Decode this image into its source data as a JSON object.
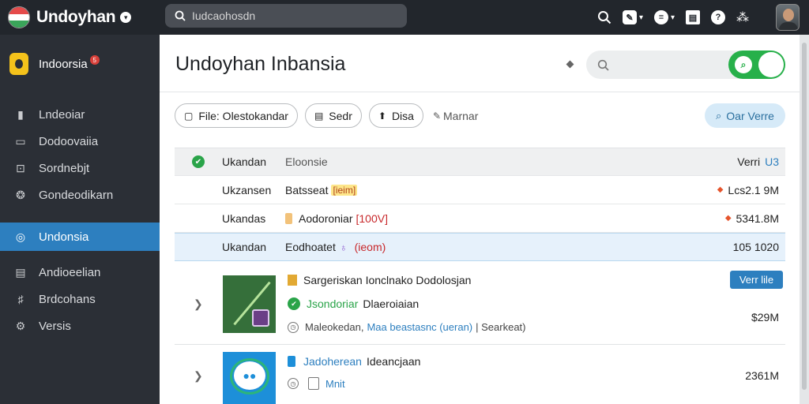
{
  "app": {
    "name": "Undoyhan",
    "search_value": "Iudcaohosdn"
  },
  "sidebar": {
    "brand_label": "Indoorsia",
    "badge": "5",
    "items": [
      {
        "label": "Lndeoiar",
        "icon": "folder-icon"
      },
      {
        "label": "Dodoovaiia",
        "icon": "inbox-icon"
      },
      {
        "label": "Sordnebjt",
        "icon": "person-icon"
      },
      {
        "label": "Gondeodikarn",
        "icon": "group-icon"
      },
      {
        "label": "Undonsia",
        "icon": "globe-icon"
      },
      {
        "label": "Andioeelian",
        "icon": "chat-icon"
      },
      {
        "label": "Brdcohans",
        "icon": "grid-icon"
      },
      {
        "label": "Versis",
        "icon": "gear-icon"
      }
    ]
  },
  "main": {
    "title": "Undoyhan Inbansia",
    "toolbar": {
      "file_label": "File: Olestokandar",
      "sedr_label": "Sedr",
      "disa_label": "Disa",
      "marnar_label": "Marnar",
      "view_label": "Oar Verre"
    },
    "table": {
      "header": {
        "name": "Ukandan",
        "desc": "Eloonsie",
        "size": "Verri",
        "size_extra": "U3"
      },
      "rows": [
        {
          "name": "Ukzansen",
          "desc": "Batsseat",
          "tag": "[ieim]",
          "size": "Lcs2.1 9M"
        },
        {
          "name": "Ukandas",
          "desc": "Aodoroniar",
          "tag": "[100V]",
          "size": "5341.8M"
        },
        {
          "name": "Ukandan",
          "desc": "Eodhoatet",
          "tag": "(ieom)",
          "size": "105 1020"
        }
      ]
    },
    "cards": [
      {
        "title": "Sargeriskan Ionclnako Dodolosjan",
        "line2_green": "Jsondoriar",
        "line2": "Dlaeroiaian",
        "line3_pre": "Maleokedan,",
        "line3_link": "Maa beastasnc (ueran)",
        "line3_post": "| Searkeat)",
        "button": "Verr lile",
        "size": "$29M"
      },
      {
        "title_blue": "Jadoherean",
        "title": "Ideancjaan",
        "line2_link": "Mnit",
        "size": "2361M"
      }
    ]
  },
  "colors": {
    "topbar": "#22262c",
    "sidebar": "#2b2f36",
    "active": "#2d7fbf",
    "green": "#27b04a"
  }
}
